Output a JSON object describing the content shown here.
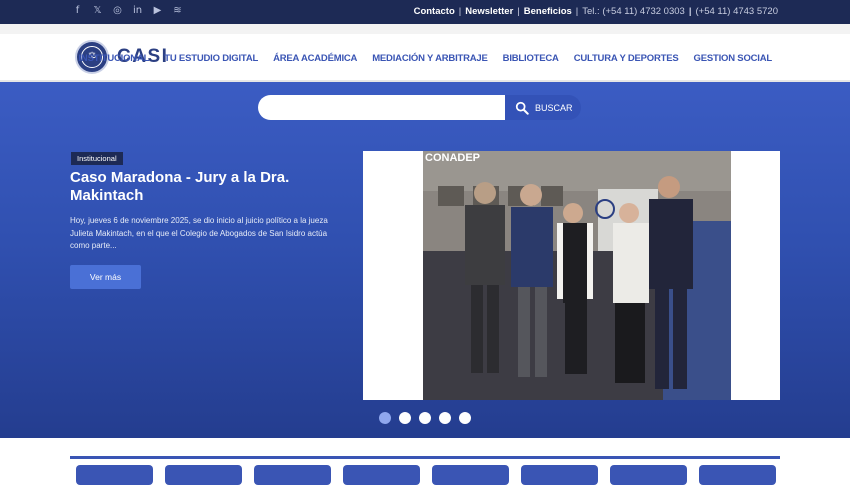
{
  "topbar": {
    "social_icons": [
      "facebook-icon",
      "x-icon",
      "instagram-icon",
      "linkedin-icon",
      "youtube-icon",
      "rss-icon"
    ],
    "links": [
      "Contacto",
      "Newsletter",
      "Beneficios"
    ],
    "phone": "Tel.: (+54 11) 4732 0303",
    "phone2": "(+54 11) 4743 5720"
  },
  "header": {
    "brand": "CASI",
    "nav": [
      "INSTITUCIONAL",
      "TU ESTUDIO DIGITAL",
      "ÁREA ACADÉMICA",
      "MEDIACIÓN Y ARBITRAJE",
      "BIBLIOTECA",
      "CULTURA Y DEPORTES",
      "GESTION SOCIAL"
    ]
  },
  "search": {
    "placeholder": "",
    "button_label": "BUSCAR"
  },
  "slide": {
    "tag": "Institucional",
    "title": "Caso Maradona - Jury a la Dra. Makintach",
    "excerpt": "Hoy, jueves 6 de noviembre 2025, se dio inicio al juicio político a la jueza Julieta Makintach, en el que el Colegio de Abogados de San Isidro actúa como parte...",
    "button": "Ver más",
    "photo_sign": "CONADEP",
    "dots": 5,
    "active_dot": 1
  },
  "colors": {
    "topbar": "#1d2a55",
    "brand": "#2b3f82",
    "nav": "#3a55b4",
    "hero": "#3050b0"
  }
}
